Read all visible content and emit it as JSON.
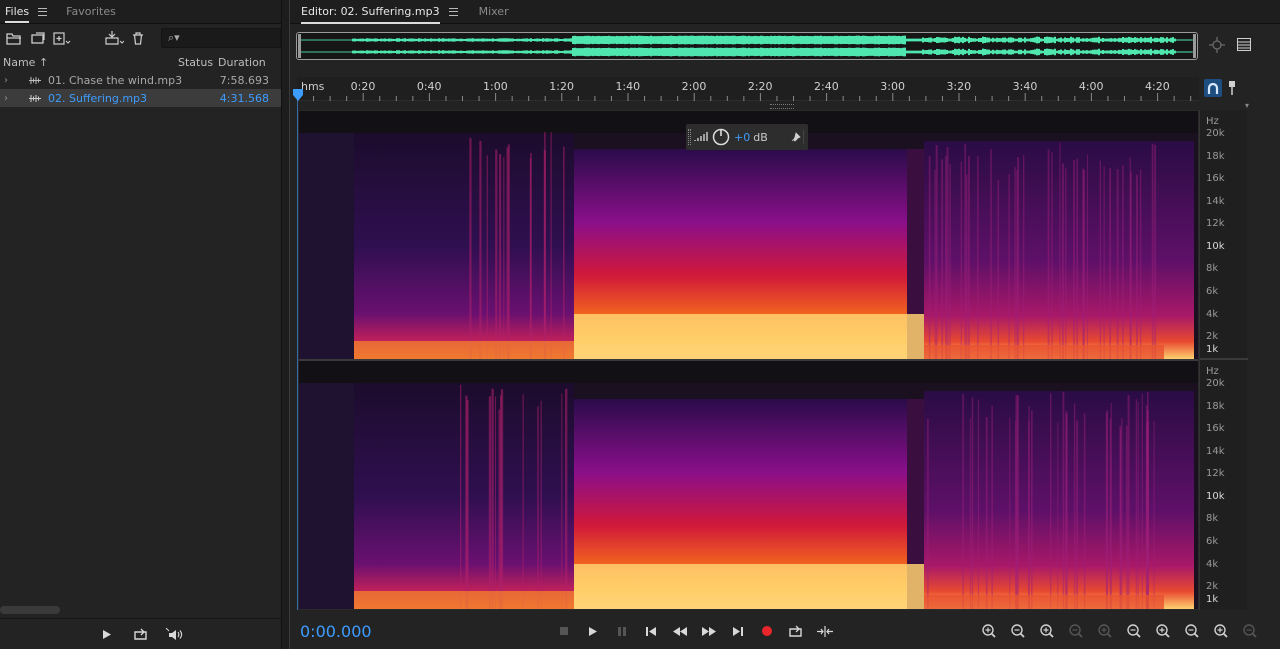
{
  "files_panel": {
    "tabs": [
      {
        "label": "Files",
        "active": true
      },
      {
        "label": "Favorites",
        "active": false
      }
    ],
    "search_placeholder": "",
    "columns": {
      "name": "Name",
      "sort_indicator": "↑",
      "status": "Status",
      "duration": "Duration"
    },
    "files": [
      {
        "name": "01. Chase the wind.mp3",
        "status": "",
        "duration": "7:58.693",
        "selected": false
      },
      {
        "name": "02. Suffering.mp3",
        "status": "",
        "duration": "4:31.568",
        "selected": true
      }
    ]
  },
  "editor": {
    "tabs": [
      {
        "label": "Editor: 02. Suffering.mp3",
        "active": true
      },
      {
        "label": "Mixer",
        "active": false
      }
    ],
    "ruler": {
      "unit_label": "hms",
      "ticks": [
        "0:20",
        "0:40",
        "1:00",
        "1:20",
        "1:40",
        "2:00",
        "2:20",
        "2:40",
        "3:00",
        "3:20",
        "3:40",
        "4:00",
        "4:20"
      ]
    },
    "hud": {
      "gain": "+0",
      "unit": "dB"
    },
    "hz_labels": [
      {
        "text": "Hz",
        "bold": false
      },
      {
        "text": "20k",
        "bold": false
      },
      {
        "text": "18k",
        "bold": false
      },
      {
        "text": "16k",
        "bold": false
      },
      {
        "text": "14k",
        "bold": false
      },
      {
        "text": "12k",
        "bold": false
      },
      {
        "text": "10k",
        "bold": true
      },
      {
        "text": "8k",
        "bold": false
      },
      {
        "text": "6k",
        "bold": false
      },
      {
        "text": "4k",
        "bold": false
      },
      {
        "text": "2k",
        "bold": false
      },
      {
        "text": "1k",
        "bold": true
      }
    ],
    "timecode": "0:00.000"
  },
  "colors": {
    "accent": "#3d9dff",
    "waveform": "#4fe6b0",
    "record": "#e8262b"
  }
}
